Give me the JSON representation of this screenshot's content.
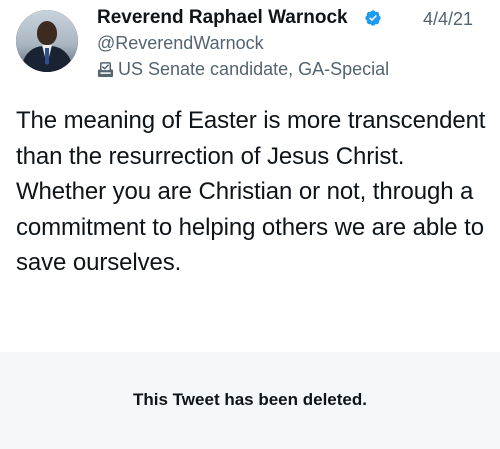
{
  "tweet": {
    "display_name": "Reverend Raphael Warnock",
    "handle": "@ReverendWarnock",
    "date": "4/4/21",
    "label": "US Senate candidate, GA-Special",
    "text": "The meaning of Easter is more transcendent than the resurrection of Jesus Christ. Whether you are Christian or not, through a commitment to helping others we are able to save ourselves.",
    "icons": {
      "verified": "verified-badge-icon",
      "label": "ballot-box-icon"
    },
    "colors": {
      "verified": "#1d9bf0",
      "secondary_text": "#536471",
      "primary_text": "#0f1419",
      "deleted_background": "#f5f8fa"
    }
  },
  "deleted_notice": {
    "text": "This Tweet has been deleted."
  }
}
